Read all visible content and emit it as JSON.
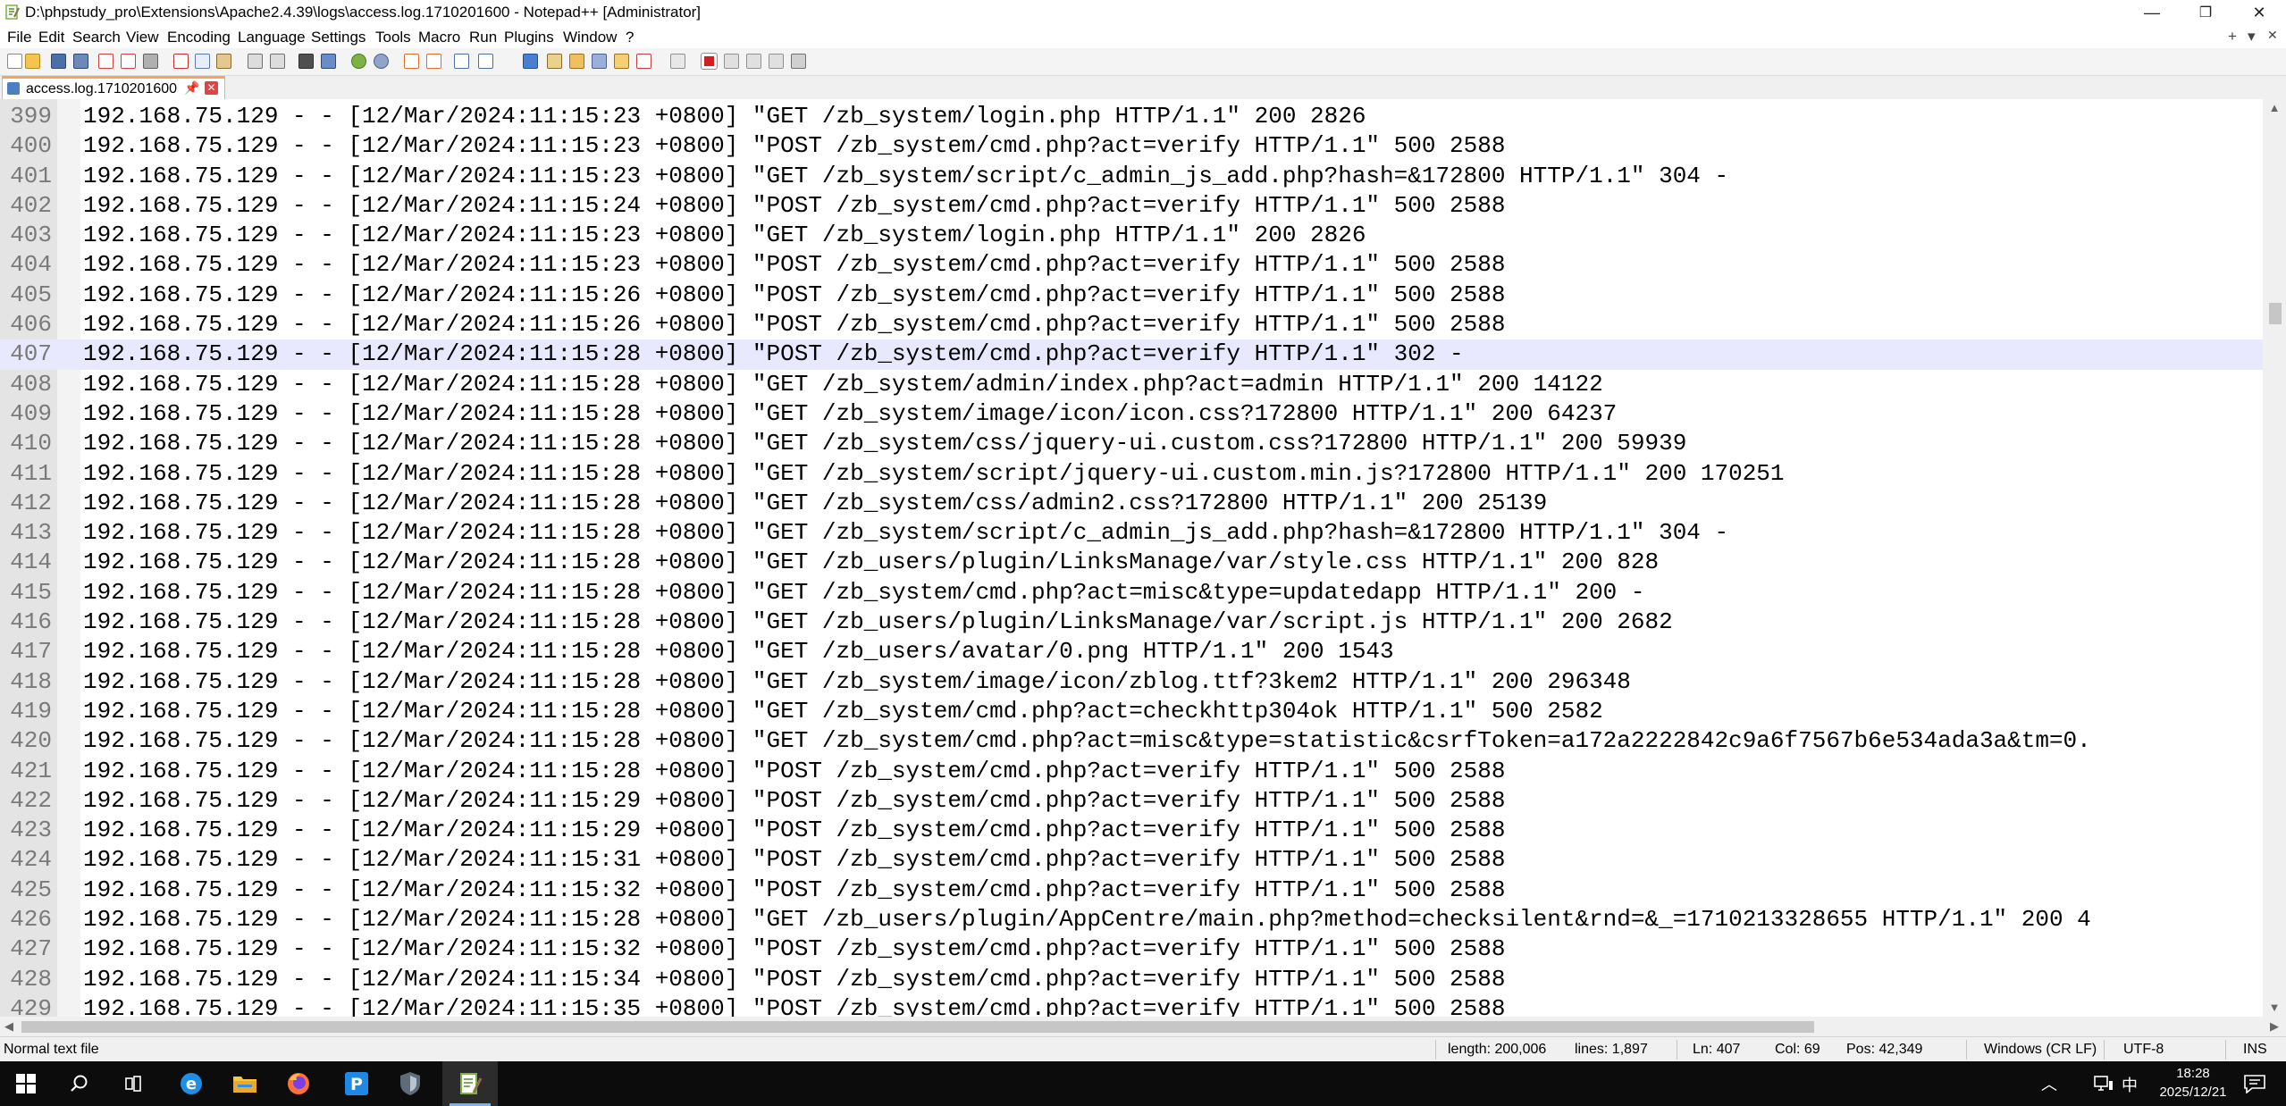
{
  "window": {
    "title": "D:\\phpstudy_pro\\Extensions\\Apache2.4.39\\logs\\access.log.1710201600 - Notepad++ [Administrator]",
    "controls": {
      "minimize": "—",
      "maximize": "❐",
      "close": "✕"
    }
  },
  "menu": {
    "items": [
      "File",
      "Edit",
      "Search",
      "View",
      "Encoding",
      "Language",
      "Settings",
      "Tools",
      "Macro",
      "Run",
      "Plugins",
      "Window",
      "?"
    ],
    "right": {
      "add": "+",
      "dropdown": "▾",
      "close": "✕"
    }
  },
  "toolbar": {
    "icons": [
      "new-file-icon",
      "open-file-icon",
      "save-icon",
      "save-all-icon",
      "close-icon",
      "close-all-icon",
      "print-icon",
      "cut-icon",
      "copy-icon",
      "paste-icon",
      "undo-icon",
      "redo-icon",
      "find-icon",
      "replace-icon",
      "zoom-in-icon",
      "zoom-out-icon",
      "sync-vertical-icon",
      "sync-horizontal-icon",
      "word-wrap-icon",
      "show-all-chars-icon",
      "indent-guide-icon",
      "user-lang-icon",
      "doc-map-icon",
      "function-list-icon",
      "folder-workspace-icon",
      "monitoring-icon",
      "record-macro-icon",
      "stop-record-icon",
      "play-macro-icon",
      "run-multiple-icon",
      "save-macro-icon"
    ]
  },
  "tab": {
    "label": "access.log.1710201600",
    "pin": "📌",
    "close": "✕"
  },
  "editor": {
    "current_line": 407,
    "lines": [
      {
        "n": "399",
        "t": "192.168.75.129 - - [12/Mar/2024:11:15:23 +0800] \"GET /zb_system/login.php HTTP/1.1\" 200 2826"
      },
      {
        "n": "400",
        "t": "192.168.75.129 - - [12/Mar/2024:11:15:23 +0800] \"POST /zb_system/cmd.php?act=verify HTTP/1.1\" 500 2588"
      },
      {
        "n": "401",
        "t": "192.168.75.129 - - [12/Mar/2024:11:15:23 +0800] \"GET /zb_system/script/c_admin_js_add.php?hash=&172800 HTTP/1.1\" 304 -"
      },
      {
        "n": "402",
        "t": "192.168.75.129 - - [12/Mar/2024:11:15:24 +0800] \"POST /zb_system/cmd.php?act=verify HTTP/1.1\" 500 2588"
      },
      {
        "n": "403",
        "t": "192.168.75.129 - - [12/Mar/2024:11:15:23 +0800] \"GET /zb_system/login.php HTTP/1.1\" 200 2826"
      },
      {
        "n": "404",
        "t": "192.168.75.129 - - [12/Mar/2024:11:15:23 +0800] \"POST /zb_system/cmd.php?act=verify HTTP/1.1\" 500 2588"
      },
      {
        "n": "405",
        "t": "192.168.75.129 - - [12/Mar/2024:11:15:26 +0800] \"POST /zb_system/cmd.php?act=verify HTTP/1.1\" 500 2588"
      },
      {
        "n": "406",
        "t": "192.168.75.129 - - [12/Mar/2024:11:15:26 +0800] \"POST /zb_system/cmd.php?act=verify HTTP/1.1\" 500 2588"
      },
      {
        "n": "407",
        "t": "192.168.75.129 - - [12/Mar/2024:11:15:28 +0800] \"POST /zb_system/cmd.php?act=verify HTTP/1.1\" 302 -"
      },
      {
        "n": "408",
        "t": "192.168.75.129 - - [12/Mar/2024:11:15:28 +0800] \"GET /zb_system/admin/index.php?act=admin HTTP/1.1\" 200 14122"
      },
      {
        "n": "409",
        "t": "192.168.75.129 - - [12/Mar/2024:11:15:28 +0800] \"GET /zb_system/image/icon/icon.css?172800 HTTP/1.1\" 200 64237"
      },
      {
        "n": "410",
        "t": "192.168.75.129 - - [12/Mar/2024:11:15:28 +0800] \"GET /zb_system/css/jquery-ui.custom.css?172800 HTTP/1.1\" 200 59939"
      },
      {
        "n": "411",
        "t": "192.168.75.129 - - [12/Mar/2024:11:15:28 +0800] \"GET /zb_system/script/jquery-ui.custom.min.js?172800 HTTP/1.1\" 200 170251"
      },
      {
        "n": "412",
        "t": "192.168.75.129 - - [12/Mar/2024:11:15:28 +0800] \"GET /zb_system/css/admin2.css?172800 HTTP/1.1\" 200 25139"
      },
      {
        "n": "413",
        "t": "192.168.75.129 - - [12/Mar/2024:11:15:28 +0800] \"GET /zb_system/script/c_admin_js_add.php?hash=&172800 HTTP/1.1\" 304 -"
      },
      {
        "n": "414",
        "t": "192.168.75.129 - - [12/Mar/2024:11:15:28 +0800] \"GET /zb_users/plugin/LinksManage/var/style.css HTTP/1.1\" 200 828"
      },
      {
        "n": "415",
        "t": "192.168.75.129 - - [12/Mar/2024:11:15:28 +0800] \"GET /zb_system/cmd.php?act=misc&type=updatedapp HTTP/1.1\" 200 -"
      },
      {
        "n": "416",
        "t": "192.168.75.129 - - [12/Mar/2024:11:15:28 +0800] \"GET /zb_users/plugin/LinksManage/var/script.js HTTP/1.1\" 200 2682"
      },
      {
        "n": "417",
        "t": "192.168.75.129 - - [12/Mar/2024:11:15:28 +0800] \"GET /zb_users/avatar/0.png HTTP/1.1\" 200 1543"
      },
      {
        "n": "418",
        "t": "192.168.75.129 - - [12/Mar/2024:11:15:28 +0800] \"GET /zb_system/image/icon/zblog.ttf?3kem2 HTTP/1.1\" 200 296348"
      },
      {
        "n": "419",
        "t": "192.168.75.129 - - [12/Mar/2024:11:15:28 +0800] \"GET /zb_system/cmd.php?act=checkhttp304ok HTTP/1.1\" 500 2582"
      },
      {
        "n": "420",
        "t": "192.168.75.129 - - [12/Mar/2024:11:15:28 +0800] \"GET /zb_system/cmd.php?act=misc&type=statistic&csrfToken=a172a2222842c9a6f7567b6e534ada3a&tm=0."
      },
      {
        "n": "421",
        "t": "192.168.75.129 - - [12/Mar/2024:11:15:28 +0800] \"POST /zb_system/cmd.php?act=verify HTTP/1.1\" 500 2588"
      },
      {
        "n": "422",
        "t": "192.168.75.129 - - [12/Mar/2024:11:15:29 +0800] \"POST /zb_system/cmd.php?act=verify HTTP/1.1\" 500 2588"
      },
      {
        "n": "423",
        "t": "192.168.75.129 - - [12/Mar/2024:11:15:29 +0800] \"POST /zb_system/cmd.php?act=verify HTTP/1.1\" 500 2588"
      },
      {
        "n": "424",
        "t": "192.168.75.129 - - [12/Mar/2024:11:15:31 +0800] \"POST /zb_system/cmd.php?act=verify HTTP/1.1\" 500 2588"
      },
      {
        "n": "425",
        "t": "192.168.75.129 - - [12/Mar/2024:11:15:32 +0800] \"POST /zb_system/cmd.php?act=verify HTTP/1.1\" 500 2588"
      },
      {
        "n": "426",
        "t": "192.168.75.129 - - [12/Mar/2024:11:15:28 +0800] \"GET /zb_users/plugin/AppCentre/main.php?method=checksilent&rnd=&_=1710213328655 HTTP/1.1\" 200 4"
      },
      {
        "n": "427",
        "t": "192.168.75.129 - - [12/Mar/2024:11:15:32 +0800] \"POST /zb_system/cmd.php?act=verify HTTP/1.1\" 500 2588"
      },
      {
        "n": "428",
        "t": "192.168.75.129 - - [12/Mar/2024:11:15:34 +0800] \"POST /zb_system/cmd.php?act=verify HTTP/1.1\" 500 2588"
      },
      {
        "n": "429",
        "t": "192.168.75.129 - - [12/Mar/2024:11:15:35 +0800] \"POST /zb_system/cmd.php?act=verify HTTP/1.1\" 500 2588"
      }
    ]
  },
  "status": {
    "file_type": "Normal text file",
    "length": "length: 200,006",
    "lines": "lines: 1,897",
    "ln": "Ln: 407",
    "col": "Col: 69",
    "pos": "Pos: 42,349",
    "eol": "Windows (CR LF)",
    "encoding": "UTF-8",
    "mode": "INS"
  },
  "taskbar": {
    "apps": [
      "windows-start-icon",
      "search-icon",
      "task-view-icon",
      "edge-icon",
      "file-explorer-icon",
      "firefox-icon",
      "phpstudy-icon",
      "shield-app-icon",
      "notepadpp-icon"
    ],
    "tray": {
      "up_arrow": "︿",
      "ime": "中",
      "time": "18:28",
      "date": "2025/12/21"
    }
  },
  "colors": {
    "current_line": "#e8e8ff",
    "gutter": "#e4e4e4",
    "tab_accent": "#f7a35c",
    "taskbar": "#0c0c0c"
  }
}
